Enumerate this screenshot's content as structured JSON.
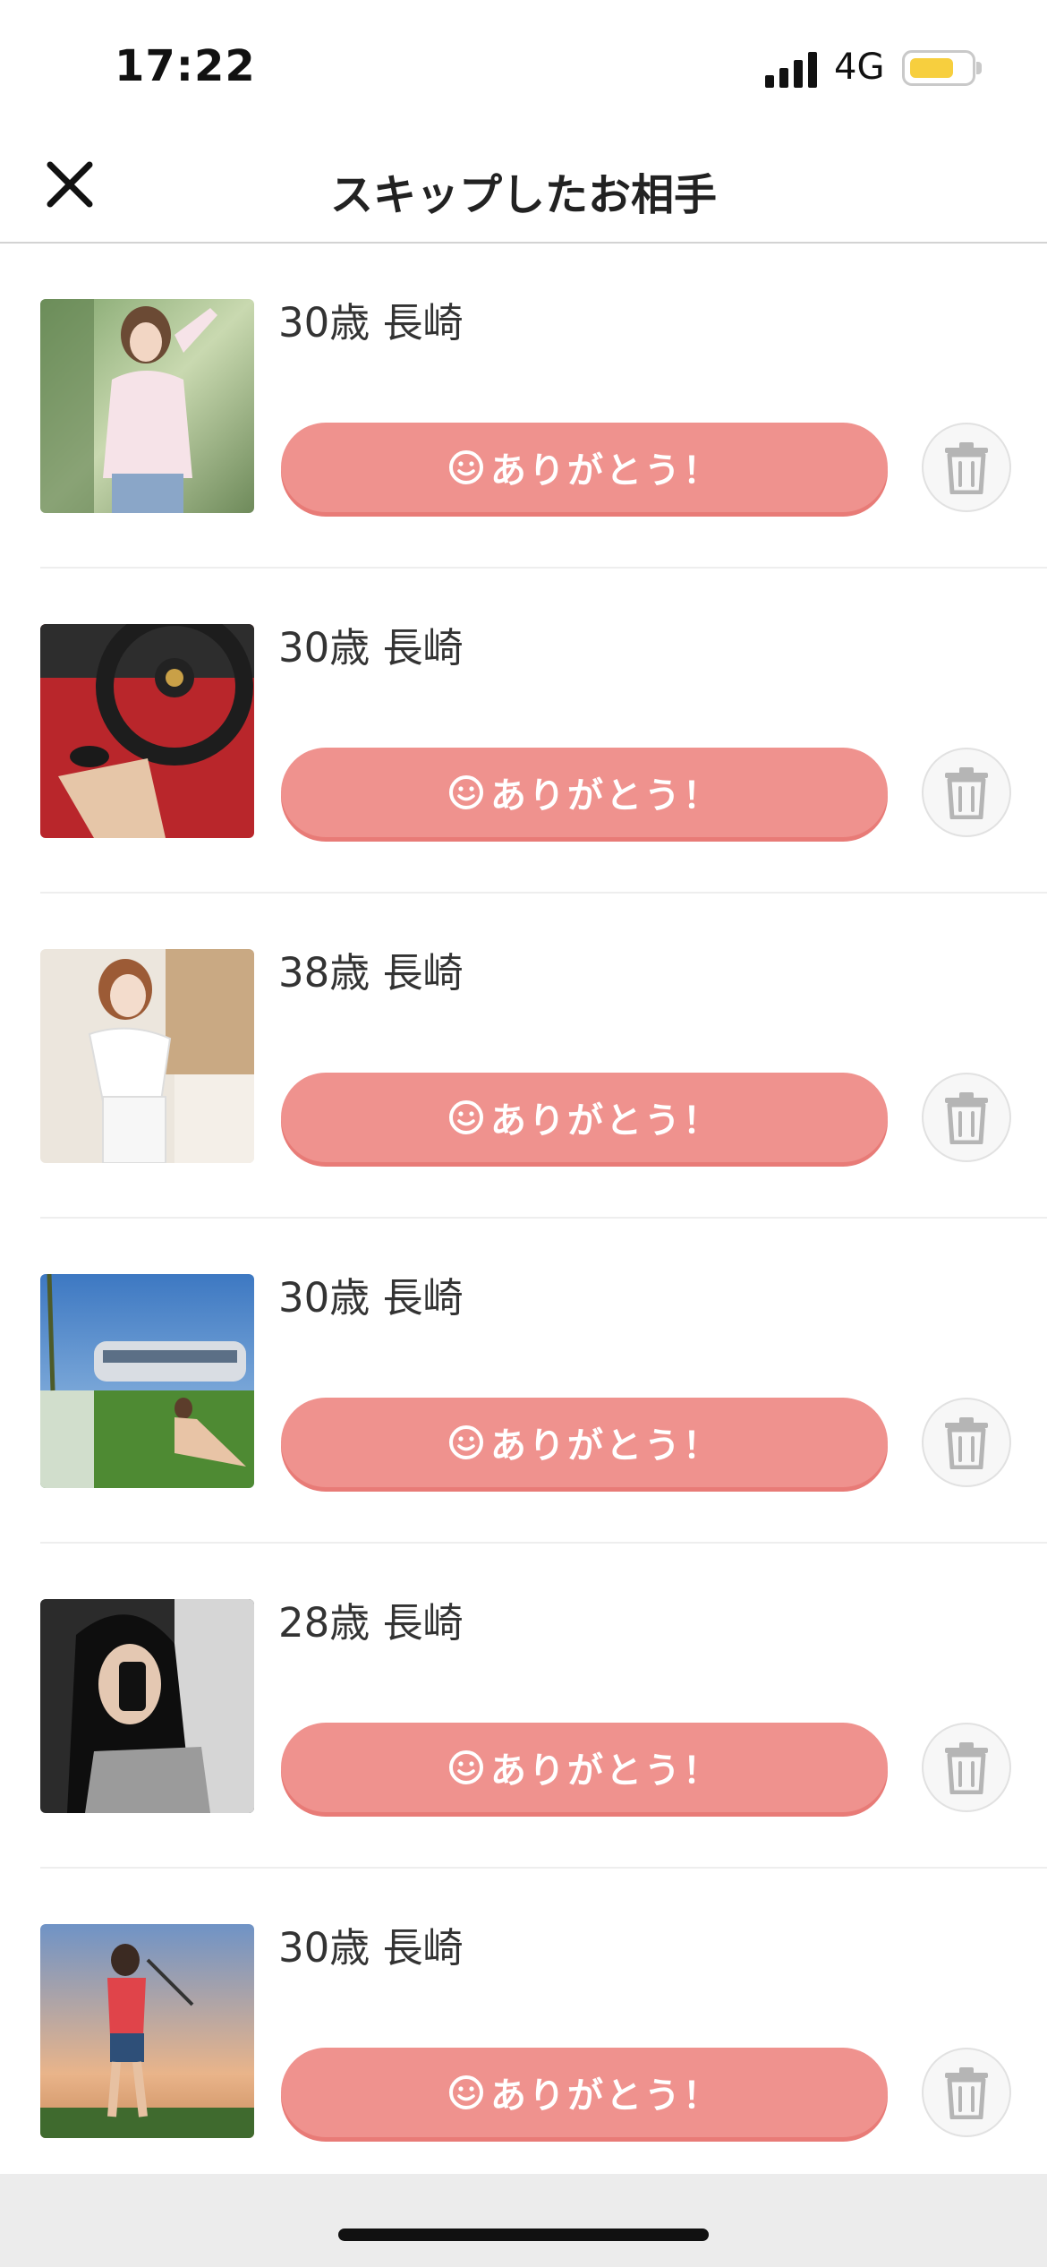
{
  "status_bar": {
    "time": "17:22",
    "network": "4G",
    "battery_level": 0.75,
    "battery_color": "#f7cf3e",
    "signal_bars": 4
  },
  "header": {
    "title": "スキップしたお相手",
    "close_icon": "close-icon"
  },
  "accent_color": "#ef928e",
  "items": [
    {
      "age": "30歳",
      "location": "長崎",
      "button_label": "ありがとう！",
      "photo_icon": "profile-photo"
    },
    {
      "age": "30歳",
      "location": "長崎",
      "button_label": "ありがとう！",
      "photo_icon": "profile-photo"
    },
    {
      "age": "38歳",
      "location": "長崎",
      "button_label": "ありがとう！",
      "photo_icon": "profile-photo"
    },
    {
      "age": "30歳",
      "location": "長崎",
      "button_label": "ありがとう！",
      "photo_icon": "profile-photo"
    },
    {
      "age": "28歳",
      "location": "長崎",
      "button_label": "ありがとう！",
      "photo_icon": "profile-photo"
    },
    {
      "age": "30歳",
      "location": "長崎",
      "button_label": "ありがとう！",
      "photo_icon": "profile-photo"
    }
  ]
}
